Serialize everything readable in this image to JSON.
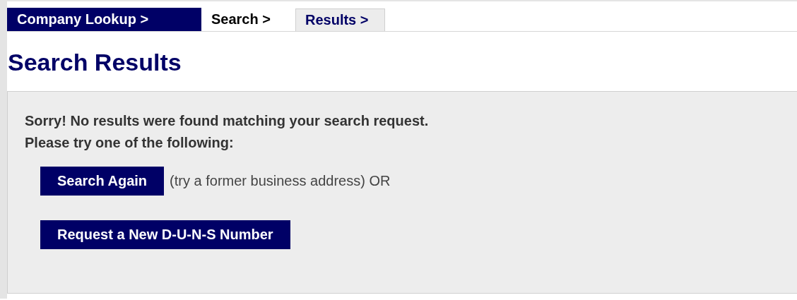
{
  "breadcrumb": [
    {
      "label": "Company Lookup >",
      "kind": "done"
    },
    {
      "label": "Search >",
      "kind": "current"
    },
    {
      "label": "Results >",
      "kind": "next"
    }
  ],
  "title": "Search Results",
  "panel": {
    "message": "Sorry! No results were found matching your search request.",
    "prompt": "Please try one of the following:",
    "actions": [
      {
        "button": "Search Again",
        "note": "(try a former business address) OR"
      },
      {
        "button": "Request a New D-U-N-S Number"
      }
    ]
  }
}
